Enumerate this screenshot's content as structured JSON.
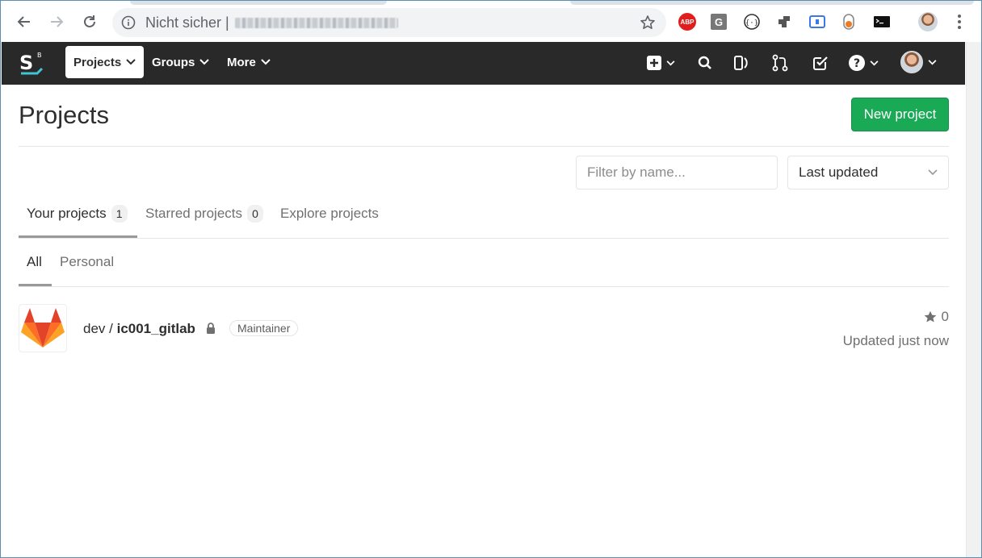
{
  "browser": {
    "security_label": "Nicht sicher",
    "separator": "|"
  },
  "nav": {
    "projects": "Projects",
    "groups": "Groups",
    "more": "More"
  },
  "page": {
    "title": "Projects",
    "new_project_button": "New project",
    "filter_placeholder": "Filter by name...",
    "sort_selected": "Last updated"
  },
  "tabs": [
    {
      "label": "Your projects",
      "count": "1",
      "active": true
    },
    {
      "label": "Starred projects",
      "count": "0",
      "active": false
    },
    {
      "label": "Explore projects",
      "count": null,
      "active": false
    }
  ],
  "subtabs": [
    {
      "label": "All",
      "active": true
    },
    {
      "label": "Personal",
      "active": false
    }
  ],
  "project": {
    "namespace": "dev / ",
    "name": "ic001_gitlab",
    "role": "Maintainer",
    "stars": "0",
    "updated": "Updated just now"
  },
  "icons": [
    "back-arrow-icon",
    "forward-arrow-icon",
    "reload-icon",
    "info-icon",
    "bookmark-star-icon",
    "adblock-icon",
    "gesture-icon",
    "code-bracket-icon",
    "puzzle-icon",
    "screen-icon",
    "toggle-icon",
    "terminal-icon",
    "user-avatar",
    "menu-dots-icon",
    "plus-icon",
    "search-icon",
    "todo-icon",
    "merge-request-icon",
    "checkbox-icon",
    "help-icon",
    "lock-icon",
    "star-icon",
    "gitlab-logo"
  ],
  "colors": {
    "navbar": "#292929",
    "primary_button": "#1aaa55"
  }
}
